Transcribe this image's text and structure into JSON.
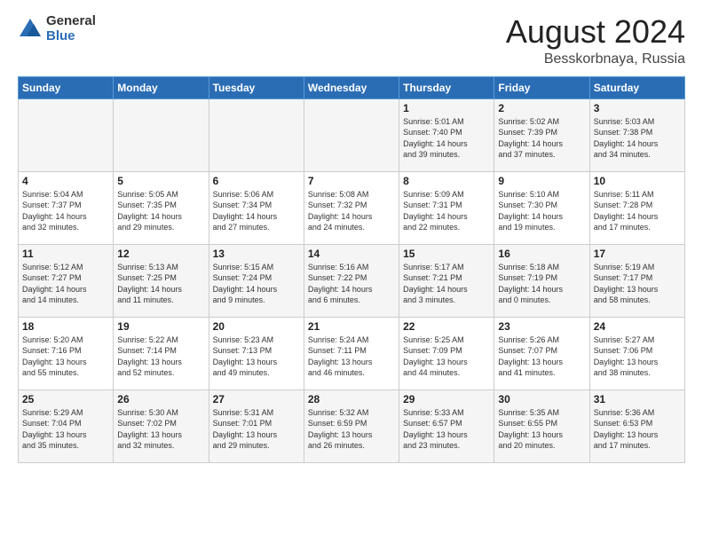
{
  "header": {
    "logo_general": "General",
    "logo_blue": "Blue",
    "month_title": "August 2024",
    "location": "Besskorbnaya, Russia"
  },
  "weekdays": [
    "Sunday",
    "Monday",
    "Tuesday",
    "Wednesday",
    "Thursday",
    "Friday",
    "Saturday"
  ],
  "weeks": [
    [
      {
        "day": "",
        "info": ""
      },
      {
        "day": "",
        "info": ""
      },
      {
        "day": "",
        "info": ""
      },
      {
        "day": "",
        "info": ""
      },
      {
        "day": "1",
        "info": "Sunrise: 5:01 AM\nSunset: 7:40 PM\nDaylight: 14 hours\nand 39 minutes."
      },
      {
        "day": "2",
        "info": "Sunrise: 5:02 AM\nSunset: 7:39 PM\nDaylight: 14 hours\nand 37 minutes."
      },
      {
        "day": "3",
        "info": "Sunrise: 5:03 AM\nSunset: 7:38 PM\nDaylight: 14 hours\nand 34 minutes."
      }
    ],
    [
      {
        "day": "4",
        "info": "Sunrise: 5:04 AM\nSunset: 7:37 PM\nDaylight: 14 hours\nand 32 minutes."
      },
      {
        "day": "5",
        "info": "Sunrise: 5:05 AM\nSunset: 7:35 PM\nDaylight: 14 hours\nand 29 minutes."
      },
      {
        "day": "6",
        "info": "Sunrise: 5:06 AM\nSunset: 7:34 PM\nDaylight: 14 hours\nand 27 minutes."
      },
      {
        "day": "7",
        "info": "Sunrise: 5:08 AM\nSunset: 7:32 PM\nDaylight: 14 hours\nand 24 minutes."
      },
      {
        "day": "8",
        "info": "Sunrise: 5:09 AM\nSunset: 7:31 PM\nDaylight: 14 hours\nand 22 minutes."
      },
      {
        "day": "9",
        "info": "Sunrise: 5:10 AM\nSunset: 7:30 PM\nDaylight: 14 hours\nand 19 minutes."
      },
      {
        "day": "10",
        "info": "Sunrise: 5:11 AM\nSunset: 7:28 PM\nDaylight: 14 hours\nand 17 minutes."
      }
    ],
    [
      {
        "day": "11",
        "info": "Sunrise: 5:12 AM\nSunset: 7:27 PM\nDaylight: 14 hours\nand 14 minutes."
      },
      {
        "day": "12",
        "info": "Sunrise: 5:13 AM\nSunset: 7:25 PM\nDaylight: 14 hours\nand 11 minutes."
      },
      {
        "day": "13",
        "info": "Sunrise: 5:15 AM\nSunset: 7:24 PM\nDaylight: 14 hours\nand 9 minutes."
      },
      {
        "day": "14",
        "info": "Sunrise: 5:16 AM\nSunset: 7:22 PM\nDaylight: 14 hours\nand 6 minutes."
      },
      {
        "day": "15",
        "info": "Sunrise: 5:17 AM\nSunset: 7:21 PM\nDaylight: 14 hours\nand 3 minutes."
      },
      {
        "day": "16",
        "info": "Sunrise: 5:18 AM\nSunset: 7:19 PM\nDaylight: 14 hours\nand 0 minutes."
      },
      {
        "day": "17",
        "info": "Sunrise: 5:19 AM\nSunset: 7:17 PM\nDaylight: 13 hours\nand 58 minutes."
      }
    ],
    [
      {
        "day": "18",
        "info": "Sunrise: 5:20 AM\nSunset: 7:16 PM\nDaylight: 13 hours\nand 55 minutes."
      },
      {
        "day": "19",
        "info": "Sunrise: 5:22 AM\nSunset: 7:14 PM\nDaylight: 13 hours\nand 52 minutes."
      },
      {
        "day": "20",
        "info": "Sunrise: 5:23 AM\nSunset: 7:13 PM\nDaylight: 13 hours\nand 49 minutes."
      },
      {
        "day": "21",
        "info": "Sunrise: 5:24 AM\nSunset: 7:11 PM\nDaylight: 13 hours\nand 46 minutes."
      },
      {
        "day": "22",
        "info": "Sunrise: 5:25 AM\nSunset: 7:09 PM\nDaylight: 13 hours\nand 44 minutes."
      },
      {
        "day": "23",
        "info": "Sunrise: 5:26 AM\nSunset: 7:07 PM\nDaylight: 13 hours\nand 41 minutes."
      },
      {
        "day": "24",
        "info": "Sunrise: 5:27 AM\nSunset: 7:06 PM\nDaylight: 13 hours\nand 38 minutes."
      }
    ],
    [
      {
        "day": "25",
        "info": "Sunrise: 5:29 AM\nSunset: 7:04 PM\nDaylight: 13 hours\nand 35 minutes."
      },
      {
        "day": "26",
        "info": "Sunrise: 5:30 AM\nSunset: 7:02 PM\nDaylight: 13 hours\nand 32 minutes."
      },
      {
        "day": "27",
        "info": "Sunrise: 5:31 AM\nSunset: 7:01 PM\nDaylight: 13 hours\nand 29 minutes."
      },
      {
        "day": "28",
        "info": "Sunrise: 5:32 AM\nSunset: 6:59 PM\nDaylight: 13 hours\nand 26 minutes."
      },
      {
        "day": "29",
        "info": "Sunrise: 5:33 AM\nSunset: 6:57 PM\nDaylight: 13 hours\nand 23 minutes."
      },
      {
        "day": "30",
        "info": "Sunrise: 5:35 AM\nSunset: 6:55 PM\nDaylight: 13 hours\nand 20 minutes."
      },
      {
        "day": "31",
        "info": "Sunrise: 5:36 AM\nSunset: 6:53 PM\nDaylight: 13 hours\nand 17 minutes."
      }
    ]
  ]
}
